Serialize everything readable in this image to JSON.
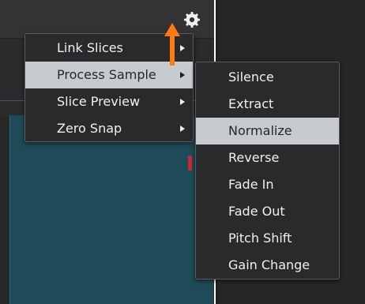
{
  "toolbar": {
    "settings_icon": "gear-icon"
  },
  "annotation": {
    "arrow_color": "#ff7a12",
    "arrow_icon": "up-arrow"
  },
  "context_menu": {
    "items": [
      {
        "label": "Link Slices",
        "has_submenu": true,
        "active": false
      },
      {
        "label": "Process Sample",
        "has_submenu": true,
        "active": true
      },
      {
        "label": "Slice Preview",
        "has_submenu": true,
        "active": false
      },
      {
        "label": "Zero Snap",
        "has_submenu": true,
        "active": false
      }
    ]
  },
  "submenu": {
    "parent": "Process Sample",
    "items": [
      {
        "label": "Silence",
        "active": false
      },
      {
        "label": "Extract",
        "active": false
      },
      {
        "label": "Normalize",
        "active": true
      },
      {
        "label": "Reverse",
        "active": false
      },
      {
        "label": "Fade In",
        "active": false
      },
      {
        "label": "Fade Out",
        "active": false
      },
      {
        "label": "Pitch Shift",
        "active": false
      },
      {
        "label": "Gain Change",
        "active": false
      }
    ]
  },
  "colors": {
    "waveform_bg": "#1f4a57",
    "menu_bg": "#2a2a2c",
    "menu_highlight": "#c7cbcd",
    "marker": "#c42a35"
  }
}
